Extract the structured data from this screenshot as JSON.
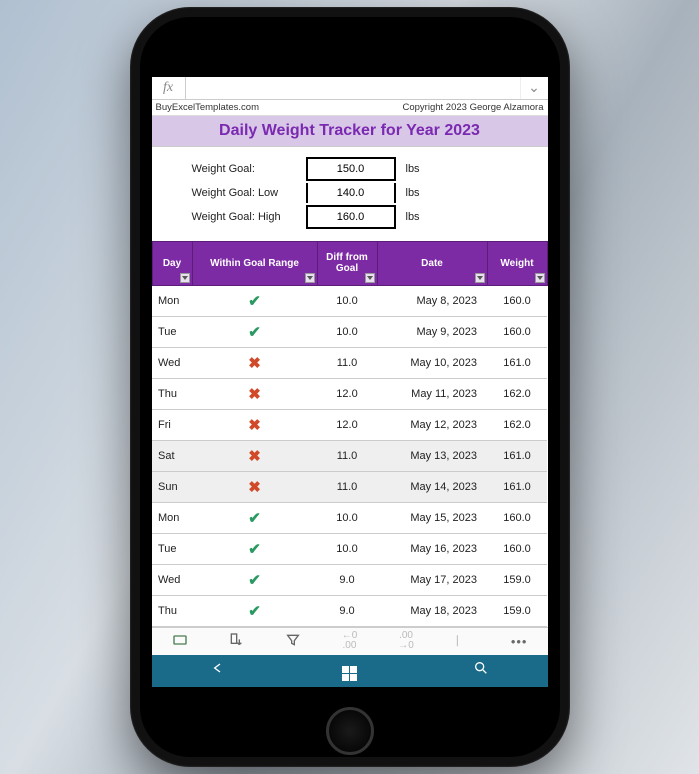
{
  "formula_bar": {
    "fx": "fx",
    "value": "",
    "expand_glyph": "⌄"
  },
  "header": {
    "site": "BuyExcelTemplates.com",
    "copyright": "Copyright 2023  George Alzamora",
    "title": "Daily Weight Tracker for Year 2023"
  },
  "goals": {
    "rows": [
      {
        "label": "Weight Goal:",
        "value": "150.0",
        "unit": "lbs"
      },
      {
        "label": "Weight Goal: Low",
        "value": "140.0",
        "unit": "lbs"
      },
      {
        "label": "Weight Goal: High",
        "value": "160.0",
        "unit": "lbs"
      }
    ]
  },
  "table": {
    "columns": [
      "Day",
      "Within Goal Range",
      "Diff from Goal",
      "Date",
      "Weight"
    ],
    "rows": [
      {
        "day": "Mon",
        "in_range": true,
        "diff": "10.0",
        "date": "May 8, 2023",
        "weight": "160.0",
        "weekend": false
      },
      {
        "day": "Tue",
        "in_range": true,
        "diff": "10.0",
        "date": "May 9, 2023",
        "weight": "160.0",
        "weekend": false
      },
      {
        "day": "Wed",
        "in_range": false,
        "diff": "11.0",
        "date": "May 10, 2023",
        "weight": "161.0",
        "weekend": false
      },
      {
        "day": "Thu",
        "in_range": false,
        "diff": "12.0",
        "date": "May 11, 2023",
        "weight": "162.0",
        "weekend": false
      },
      {
        "day": "Fri",
        "in_range": false,
        "diff": "12.0",
        "date": "May 12, 2023",
        "weight": "162.0",
        "weekend": false
      },
      {
        "day": "Sat",
        "in_range": false,
        "diff": "11.0",
        "date": "May 13, 2023",
        "weight": "161.0",
        "weekend": true
      },
      {
        "day": "Sun",
        "in_range": false,
        "diff": "11.0",
        "date": "May 14, 2023",
        "weight": "161.0",
        "weekend": true
      },
      {
        "day": "Mon",
        "in_range": true,
        "diff": "10.0",
        "date": "May 15, 2023",
        "weight": "160.0",
        "weekend": false
      },
      {
        "day": "Tue",
        "in_range": true,
        "diff": "10.0",
        "date": "May 16, 2023",
        "weight": "160.0",
        "weekend": false
      },
      {
        "day": "Wed",
        "in_range": true,
        "diff": "9.0",
        "date": "May 17, 2023",
        "weight": "159.0",
        "weekend": false
      },
      {
        "day": "Thu",
        "in_range": true,
        "diff": "9.0",
        "date": "May 18, 2023",
        "weight": "159.0",
        "weekend": false
      }
    ]
  },
  "toolbar": {
    "items": [
      {
        "name": "card-view-icon"
      },
      {
        "name": "sort-icon"
      },
      {
        "name": "filter-icon"
      },
      {
        "name": "decrease-decimal-icon"
      },
      {
        "name": "increase-decimal-icon"
      },
      {
        "name": "more-partial-icon"
      },
      {
        "name": "more-icon"
      }
    ]
  },
  "bottom_nav": {
    "items": [
      {
        "name": "back-icon"
      },
      {
        "name": "windows-icon"
      },
      {
        "name": "search-icon"
      }
    ]
  },
  "chart_data": {
    "type": "table",
    "title": "Daily Weight Tracker for Year 2023",
    "columns": [
      "Day",
      "Within Goal Range",
      "Diff from Goal",
      "Date",
      "Weight"
    ],
    "rows": [
      [
        "Mon",
        true,
        10.0,
        "May 8, 2023",
        160.0
      ],
      [
        "Tue",
        true,
        10.0,
        "May 9, 2023",
        160.0
      ],
      [
        "Wed",
        false,
        11.0,
        "May 10, 2023",
        161.0
      ],
      [
        "Thu",
        false,
        12.0,
        "May 11, 2023",
        162.0
      ],
      [
        "Fri",
        false,
        12.0,
        "May 12, 2023",
        162.0
      ],
      [
        "Sat",
        false,
        11.0,
        "May 13, 2023",
        161.0
      ],
      [
        "Sun",
        false,
        11.0,
        "May 14, 2023",
        161.0
      ],
      [
        "Mon",
        true,
        10.0,
        "May 15, 2023",
        160.0
      ],
      [
        "Tue",
        true,
        10.0,
        "May 16, 2023",
        160.0
      ],
      [
        "Wed",
        true,
        9.0,
        "May 17, 2023",
        159.0
      ],
      [
        "Thu",
        true,
        9.0,
        "May 18, 2023",
        159.0
      ]
    ],
    "goals": {
      "target": 150.0,
      "low": 140.0,
      "high": 160.0,
      "unit": "lbs"
    }
  }
}
